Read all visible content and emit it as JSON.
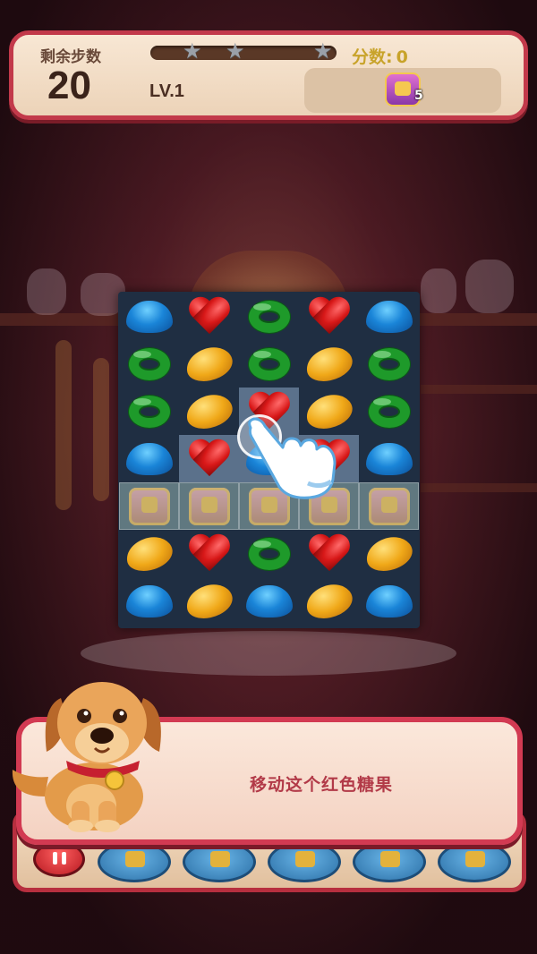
{
  "hud": {
    "moves_label": "剩余步数",
    "moves_value": "20",
    "level": "LV.1",
    "score_label": "分数:",
    "score_value": "0",
    "progress": 0.0,
    "stars": [
      "star-icon",
      "star-icon",
      "star-icon"
    ],
    "goal": {
      "icon": "gift-box-icon",
      "count": "5"
    }
  },
  "board": {
    "rows": [
      [
        "drop",
        "heart",
        "ring",
        "heart",
        "drop"
      ],
      [
        "ring",
        "lemon",
        "ring",
        "lemon",
        "ring"
      ],
      [
        "ring",
        "lemon",
        "heart",
        "lemon",
        "ring"
      ],
      [
        "drop",
        "heart",
        "drop",
        "heart",
        "drop"
      ],
      [
        "box",
        "box",
        "box",
        "box",
        "box"
      ],
      [
        "lemon",
        "heart",
        "ring",
        "heart",
        "lemon"
      ],
      [
        "drop",
        "lemon",
        "drop",
        "lemon",
        "drop"
      ]
    ],
    "highlighted": [
      "2-2",
      "3-1",
      "3-2",
      "3-3"
    ]
  },
  "tutorial": {
    "text": "移动这个红色糖果",
    "pointer_icon": "hand-pointer-icon",
    "character": "dog-icon"
  },
  "bottom_bar": {
    "pause_icon": "pause-icon",
    "slots": [
      "locked-slot",
      "locked-slot",
      "locked-slot",
      "locked-slot",
      "locked-slot"
    ]
  },
  "colors": {
    "frame_red": "#c2394a",
    "candy_blue": "#1a85d8",
    "candy_red": "#d81818",
    "candy_green": "#1e9a2a",
    "candy_yellow": "#f0a818",
    "dialog_text": "#b23a48"
  }
}
